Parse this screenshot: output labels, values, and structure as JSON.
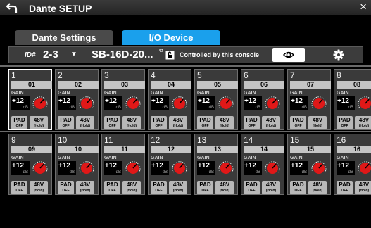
{
  "header": {
    "title": "Dante SETUP",
    "back_icon": "back-arrow-icon",
    "close_label": "×"
  },
  "tabs": [
    {
      "label": "Dante Settings",
      "active": false
    },
    {
      "label": "I/O Device",
      "active": true
    }
  ],
  "device": {
    "id_label": "ID#",
    "id_value": "2-3",
    "dropdown_glyph": "▼",
    "name": "SB-16D-20...",
    "edit_glyph": "⧉",
    "controlled_text": "Controlled by this console"
  },
  "channel_labels": {
    "gain": "GAIN",
    "unit": "dB",
    "pad": "PAD",
    "pad_state": "OFF",
    "phantom": "48V",
    "phantom_state": "(Hold)"
  },
  "channels": [
    {
      "num": "1",
      "name": "01",
      "gain": "+12"
    },
    {
      "num": "2",
      "name": "02",
      "gain": "+12"
    },
    {
      "num": "3",
      "name": "03",
      "gain": "+12"
    },
    {
      "num": "4",
      "name": "04",
      "gain": "+12"
    },
    {
      "num": "5",
      "name": "05",
      "gain": "+12"
    },
    {
      "num": "6",
      "name": "06",
      "gain": "+12"
    },
    {
      "num": "7",
      "name": "07",
      "gain": "+12"
    },
    {
      "num": "8",
      "name": "08",
      "gain": "+12"
    },
    {
      "num": "9",
      "name": "09",
      "gain": "+12"
    },
    {
      "num": "10",
      "name": "10",
      "gain": "+12"
    },
    {
      "num": "11",
      "name": "11",
      "gain": "+12"
    },
    {
      "num": "12",
      "name": "12",
      "gain": "+12"
    },
    {
      "num": "13",
      "name": "13",
      "gain": "+12"
    },
    {
      "num": "14",
      "name": "14",
      "gain": "+12"
    },
    {
      "num": "15",
      "name": "15",
      "gain": "+12"
    },
    {
      "num": "16",
      "name": "16",
      "gain": "+12"
    }
  ],
  "colors": {
    "accent": "#1aa0ec",
    "knob": "#e01818",
    "panel": "#3a3a3a"
  }
}
